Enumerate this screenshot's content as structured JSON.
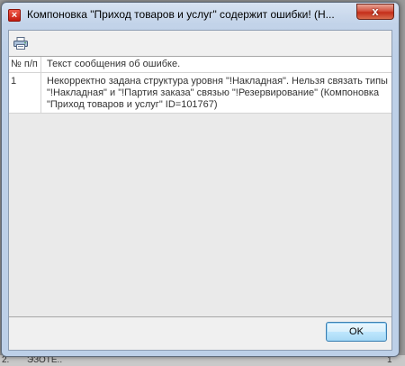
{
  "window": {
    "title": "Компоновка \"Приход товаров и услуг\" содержит ошибки! (Н...",
    "close_glyph": "x"
  },
  "toolbar": {
    "print_icon": "print-icon"
  },
  "table": {
    "columns": [
      "№ п/п",
      "Текст сообщения об ошибке."
    ],
    "rows": [
      {
        "num": "1",
        "text": "Некорректно задана структура уровня \"!Накладная\". Нельзя связать типы \"!Накладная\" и \"!Партия заказа\" связью \"!Резервирование\" (Компоновка \"Приход товаров и услуг\" ID=101767)"
      }
    ]
  },
  "footer": {
    "ok_label": "OK"
  },
  "background_strip": [
    "2.",
    "ЭЗОТЕ..",
    "1"
  ]
}
